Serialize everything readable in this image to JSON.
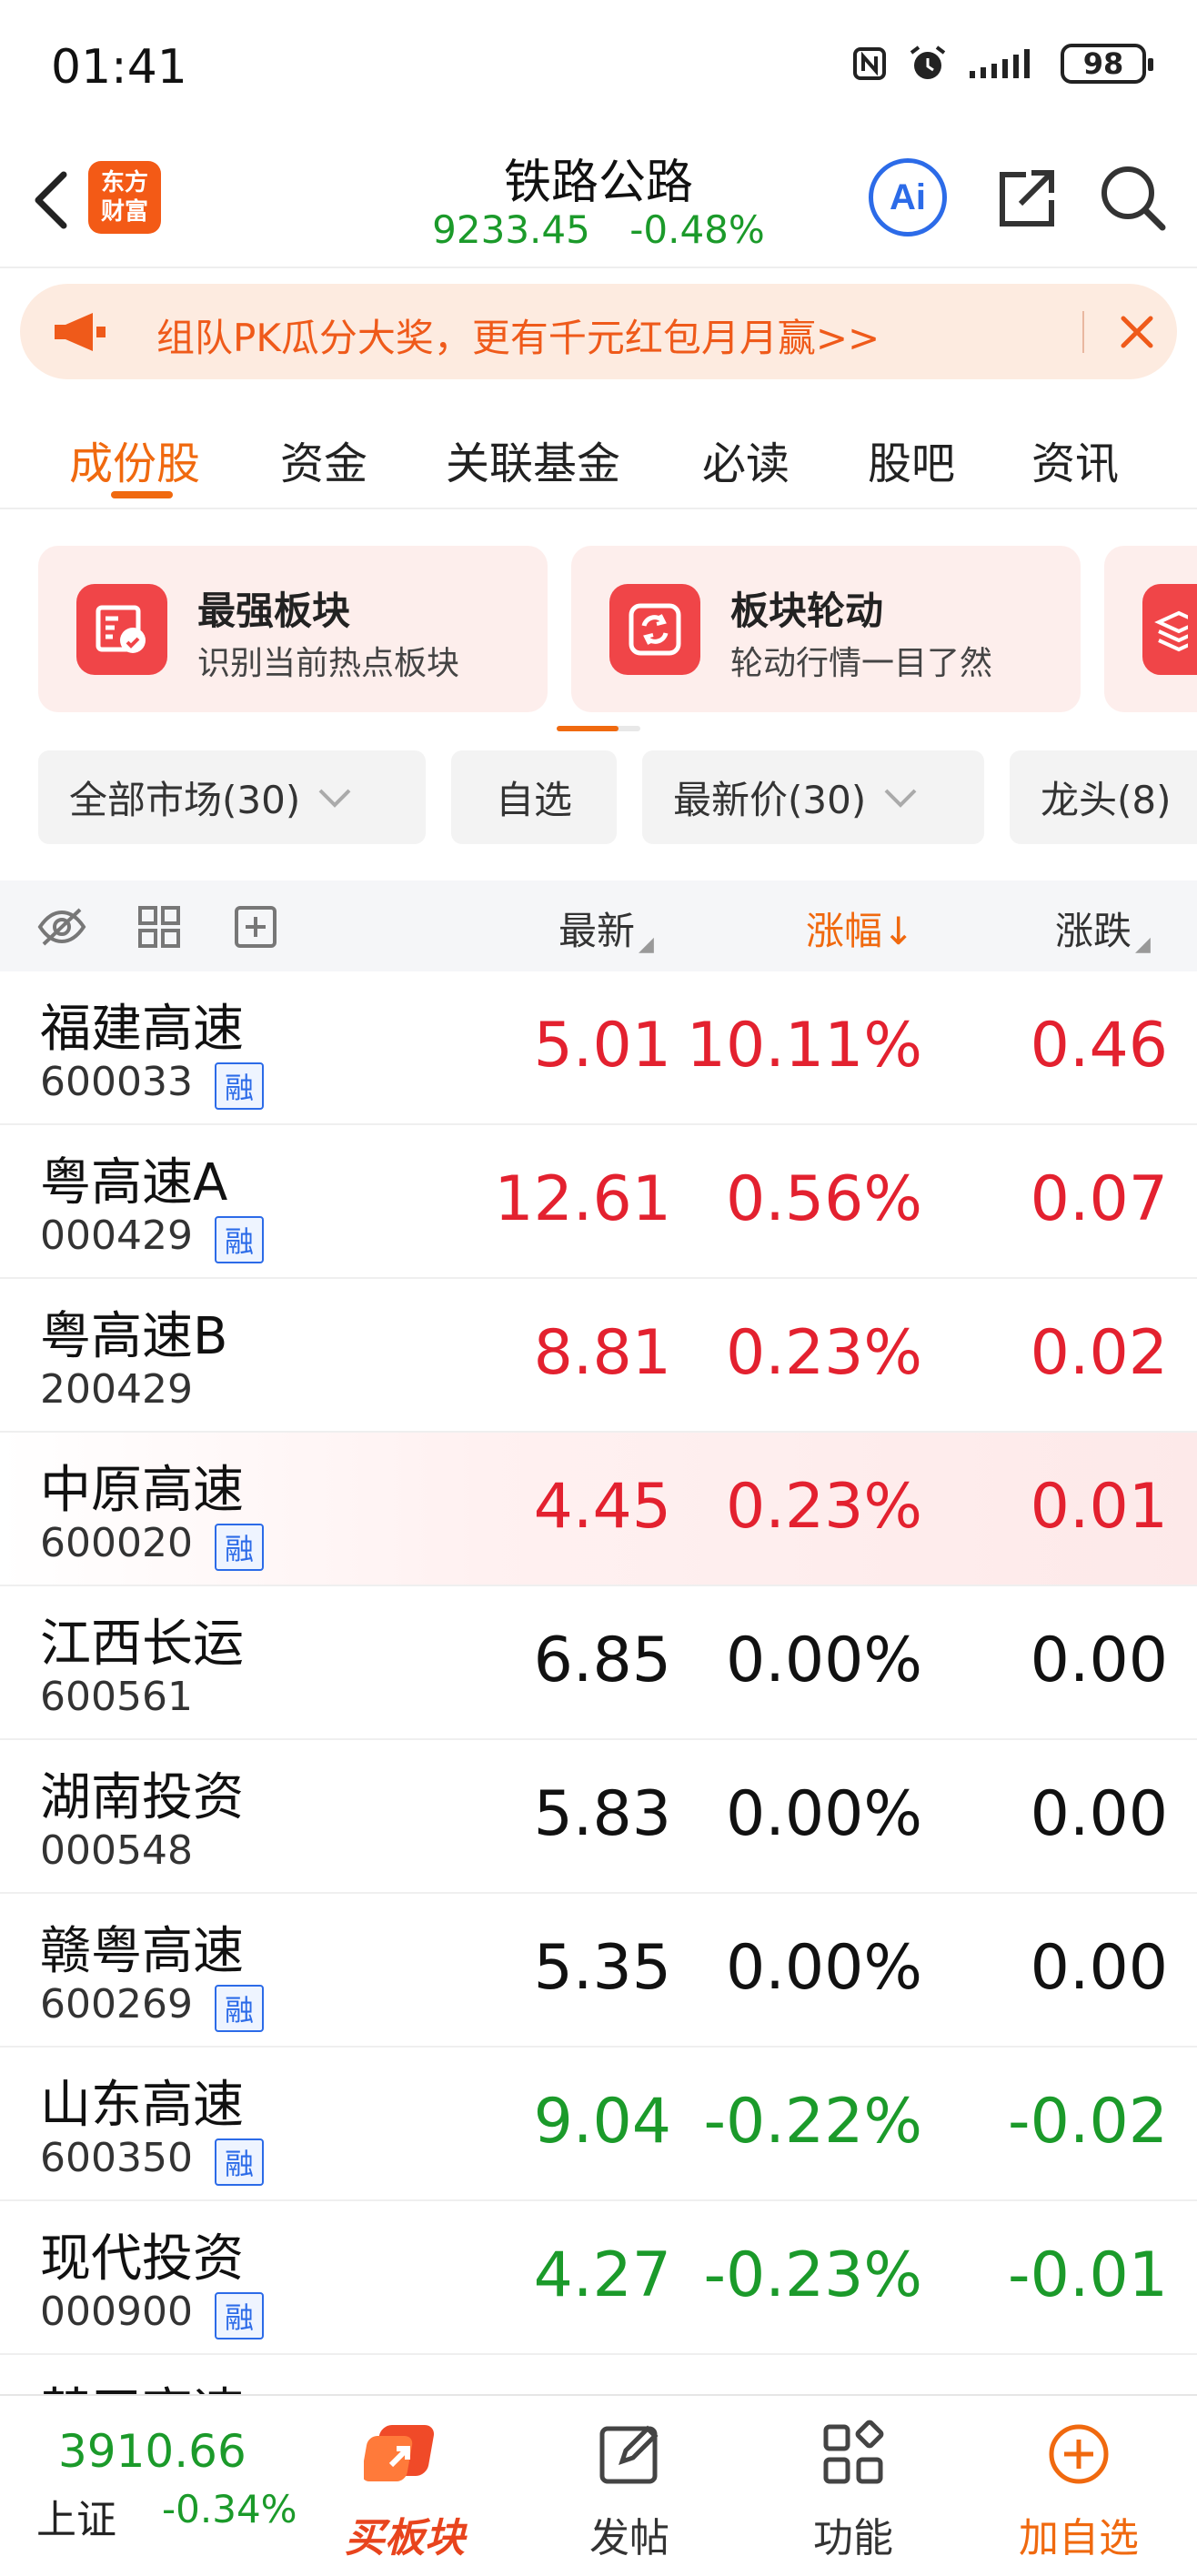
{
  "status_bar": {
    "time": "01:41",
    "battery": "98"
  },
  "header": {
    "logo_text_line1": "东方",
    "logo_text_line2": "财富",
    "title": "铁路公路",
    "index_value": "9233.45",
    "index_change": "-0.48%",
    "ai_label": "Ai"
  },
  "banner": {
    "text": "组队PK瓜分大奖，更有千元红包月月赢>>"
  },
  "tabs": [
    "成份股",
    "资金",
    "关联基金",
    "必读",
    "股吧",
    "资讯"
  ],
  "cards": [
    {
      "title": "最强板块",
      "desc": "识别当前热点板块"
    },
    {
      "title": "板块轮动",
      "desc": "轮动行情一目了然"
    }
  ],
  "filters": [
    "全部市场(30)",
    "自选",
    "最新价(30)",
    "龙头(8)"
  ],
  "table_header": {
    "latest": "最新",
    "pct": "涨幅",
    "change": "涨跌",
    "sort_arrow": "↓",
    "asc_desc_mark": "◢"
  },
  "margin_badge": "融",
  "rows": [
    {
      "name": "福建高速",
      "code": "600033",
      "margin": true,
      "price": "5.01",
      "pct": "10.11%",
      "change": "0.46",
      "dir": "up"
    },
    {
      "name": "粤高速A",
      "code": "000429",
      "margin": true,
      "price": "12.61",
      "pct": "0.56%",
      "change": "0.07",
      "dir": "up"
    },
    {
      "name": "粤高速B",
      "code": "200429",
      "margin": false,
      "price": "8.81",
      "pct": "0.23%",
      "change": "0.02",
      "dir": "up"
    },
    {
      "name": "中原高速",
      "code": "600020",
      "margin": true,
      "price": "4.45",
      "pct": "0.23%",
      "change": "0.01",
      "dir": "up",
      "highlight": true
    },
    {
      "name": "江西长运",
      "code": "600561",
      "margin": false,
      "price": "6.85",
      "pct": "0.00%",
      "change": "0.00",
      "dir": "flat"
    },
    {
      "name": "湖南投资",
      "code": "000548",
      "margin": false,
      "price": "5.83",
      "pct": "0.00%",
      "change": "0.00",
      "dir": "flat"
    },
    {
      "name": "赣粤高速",
      "code": "600269",
      "margin": true,
      "price": "5.35",
      "pct": "0.00%",
      "change": "0.00",
      "dir": "flat"
    },
    {
      "name": "山东高速",
      "code": "600350",
      "margin": true,
      "price": "9.04",
      "pct": "-0.22%",
      "change": "-0.02",
      "dir": "down"
    },
    {
      "name": "现代投资",
      "code": "000900",
      "margin": true,
      "price": "4.27",
      "pct": "-0.23%",
      "change": "-0.01",
      "dir": "down"
    },
    {
      "name": "楚天高速",
      "code": "",
      "margin": false,
      "price": "",
      "pct": "",
      "change": "",
      "dir": "flat"
    }
  ],
  "bottom_bar": {
    "index_value": "3910.66",
    "index_name": "上证",
    "index_pct": "-0.34%",
    "nav": [
      {
        "label": "买板块",
        "icon": "buy-sector-icon"
      },
      {
        "label": "发帖",
        "icon": "post-edit-icon"
      },
      {
        "label": "功能",
        "icon": "grid-apps-icon"
      },
      {
        "label": "加自选",
        "icon": "add-circle-icon"
      }
    ]
  },
  "colors": {
    "up": "#e3212f",
    "down": "#1b9a2a",
    "accent": "#f0690f",
    "ai_blue": "#2c6be8"
  }
}
